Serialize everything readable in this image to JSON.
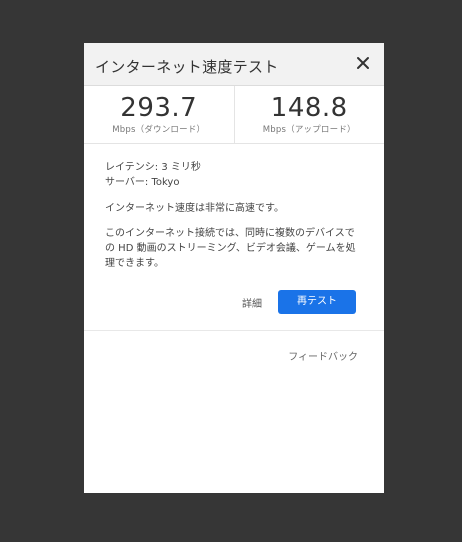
{
  "dialog": {
    "title": "インターネット速度テスト",
    "close_icon": "close-icon"
  },
  "download": {
    "value": "293.7",
    "unit": "Mbps（ダウンロード）"
  },
  "upload": {
    "value": "148.8",
    "unit": "Mbps（アップロード）"
  },
  "info": {
    "latency": "レイテンシ: 3 ミリ秒",
    "server": "サーバー: Tokyo",
    "verdict": "インターネット速度は非常に高速です。",
    "description": "このインターネット接続では、同時に複数のデバイスでの HD 動画のストリーミング、ビデオ会議、ゲームを処理できます。"
  },
  "actions": {
    "details_label": "詳細",
    "retest_label": "再テスト"
  },
  "footer": {
    "feedback_label": "フィードバック"
  },
  "colors": {
    "backdrop": "#363636",
    "header": "#f2f2f2",
    "accent": "#1a73e8"
  }
}
